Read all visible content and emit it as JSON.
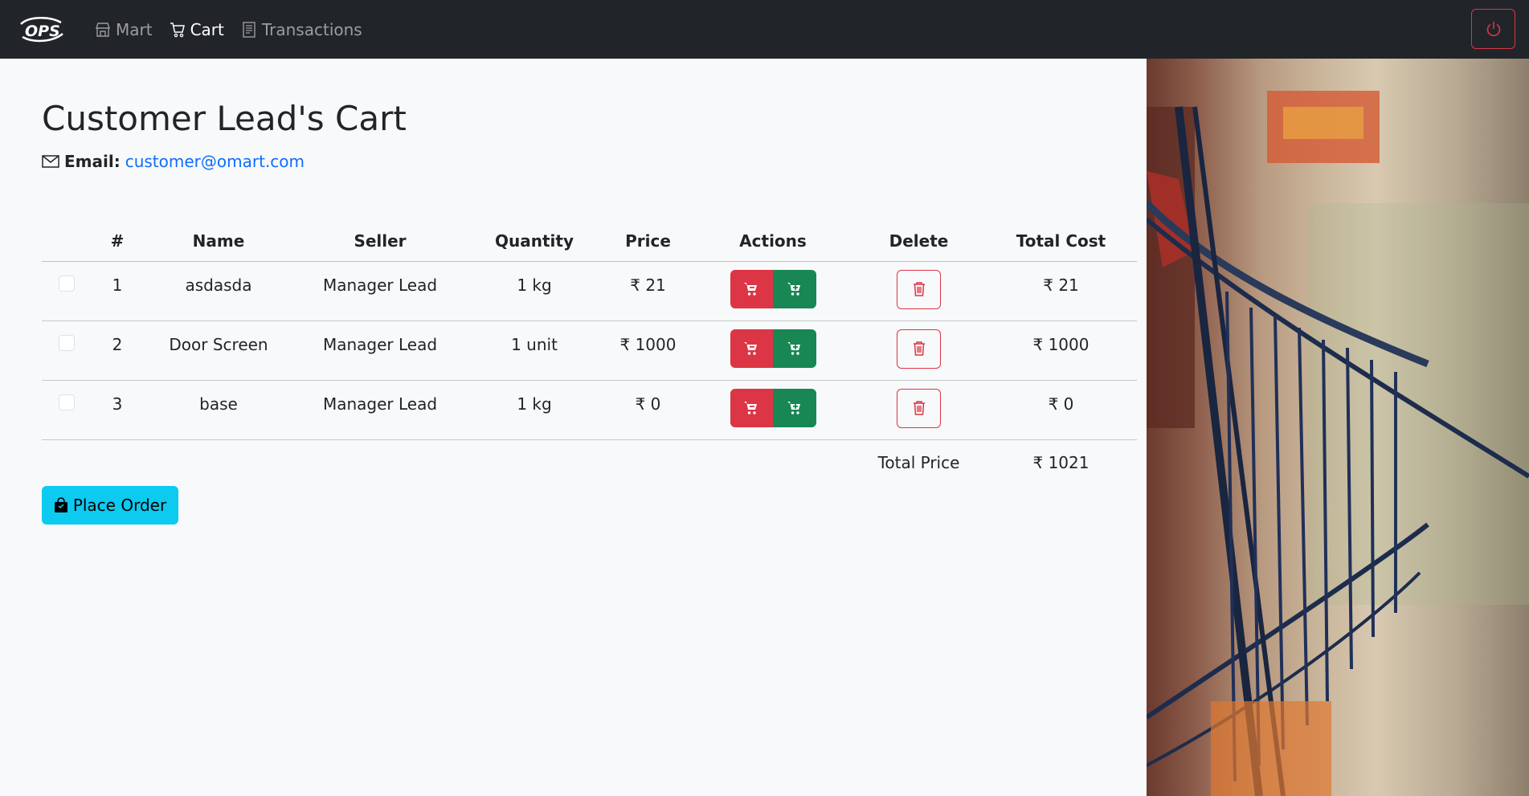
{
  "nav": {
    "brand": "OPS",
    "links": [
      {
        "label": "Mart",
        "icon": "shop-icon",
        "active": false
      },
      {
        "label": "Cart",
        "icon": "cart-icon",
        "active": true
      },
      {
        "label": "Transactions",
        "icon": "receipt-icon",
        "active": false
      }
    ],
    "logout_icon": "power-icon"
  },
  "page": {
    "title": "Customer Lead's Cart",
    "email_label": "Email:",
    "email": "customer@omart.com"
  },
  "table": {
    "headers": [
      "",
      "#",
      "Name",
      "Seller",
      "Quantity",
      "Price",
      "Actions",
      "Delete",
      "Total Cost"
    ],
    "rows": [
      {
        "index": "1",
        "name": "asdasda",
        "seller": "Manager Lead",
        "quantity": "1 kg",
        "price": "₹ 21",
        "total": "₹ 21"
      },
      {
        "index": "2",
        "name": "Door Screen",
        "seller": "Manager Lead",
        "quantity": "1 unit",
        "price": "₹ 1000",
        "total": "₹ 1000"
      },
      {
        "index": "3",
        "name": "base",
        "seller": "Manager Lead",
        "quantity": "1 kg",
        "price": "₹ 0",
        "total": "₹ 0"
      }
    ],
    "total_label": "Total Price",
    "total_value": "₹ 1021"
  },
  "actions": {
    "place_order": "Place Order"
  },
  "colors": {
    "navbar": "#212529",
    "danger": "#dc3545",
    "success": "#198754",
    "info": "#0dcaf0",
    "link": "#0d6efd"
  }
}
